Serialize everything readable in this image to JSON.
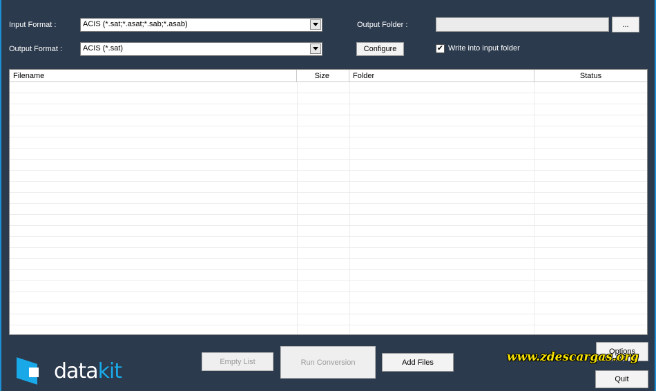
{
  "form": {
    "input_format_label": "Input Format :",
    "input_format_value": "ACIS (*.sat;*.asat;*.sab;*.asab)",
    "output_format_label": "Output Format :",
    "output_format_value": "ACIS (*.sat)",
    "output_folder_label": "Output Folder :",
    "output_folder_value": "",
    "browse_label": "...",
    "configure_label": "Configure",
    "write_into_input_label": "Write into input folder",
    "write_into_input_checked": true
  },
  "table": {
    "columns": [
      "Filename",
      "Size",
      "Folder",
      "Status"
    ],
    "rows": []
  },
  "buttons": {
    "empty_list": "Empty List",
    "run_conversion": "Run Conversion",
    "add_files": "Add Files",
    "options": "Options",
    "quit": "Quit"
  },
  "logo": {
    "text_a": "data",
    "text_b": "kit"
  },
  "watermark": "www.zdescargas.org",
  "colors": {
    "background": "#2b3a4d",
    "accent": "#1aa9e8",
    "watermark": "#f5e200"
  }
}
